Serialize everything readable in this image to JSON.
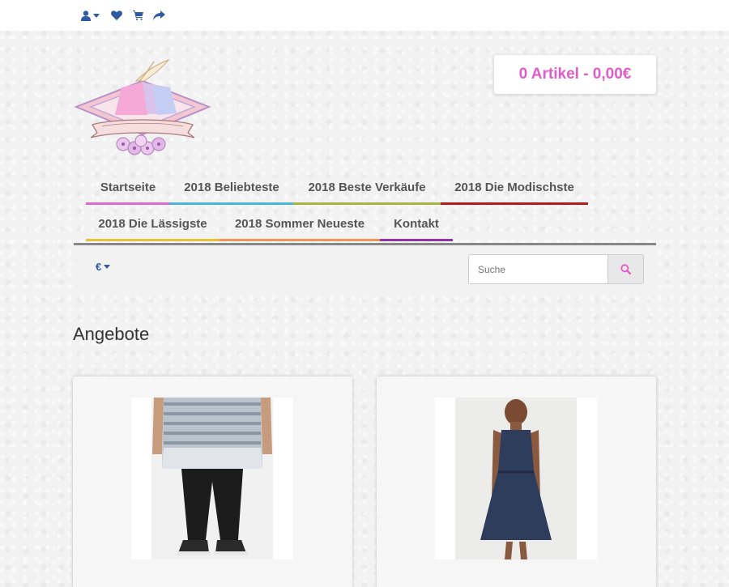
{
  "topbar": {
    "icons": [
      "user-icon",
      "heart-icon",
      "cart-icon",
      "share-icon"
    ]
  },
  "cart": {
    "summary": "0 Artikel - 0,00€"
  },
  "nav": {
    "items": [
      {
        "label": "Startseite",
        "color": "#d96bcf"
      },
      {
        "label": "2018 Beliebteste",
        "color": "#4db6d8"
      },
      {
        "label": "2018 Beste Verkäufe",
        "color": "#a8b545"
      },
      {
        "label": "2018 Die Modischste",
        "color": "#b51c1c"
      },
      {
        "label": "2018 Die Lässigste",
        "color": "#e6c23a"
      },
      {
        "label": "2018 Sommer Neueste",
        "color": "#ee9455"
      },
      {
        "label": "Kontakt",
        "color": "#8e35a8"
      }
    ]
  },
  "currency": {
    "symbol": "€"
  },
  "search": {
    "placeholder": "Suche"
  },
  "main": {
    "heading": "Angebote"
  },
  "products": [
    {
      "image": "man-tshirt-photo"
    },
    {
      "image": "woman-dress-photo"
    }
  ],
  "colors": {
    "accent": "#e05cc9",
    "link": "#2d5aa0"
  }
}
